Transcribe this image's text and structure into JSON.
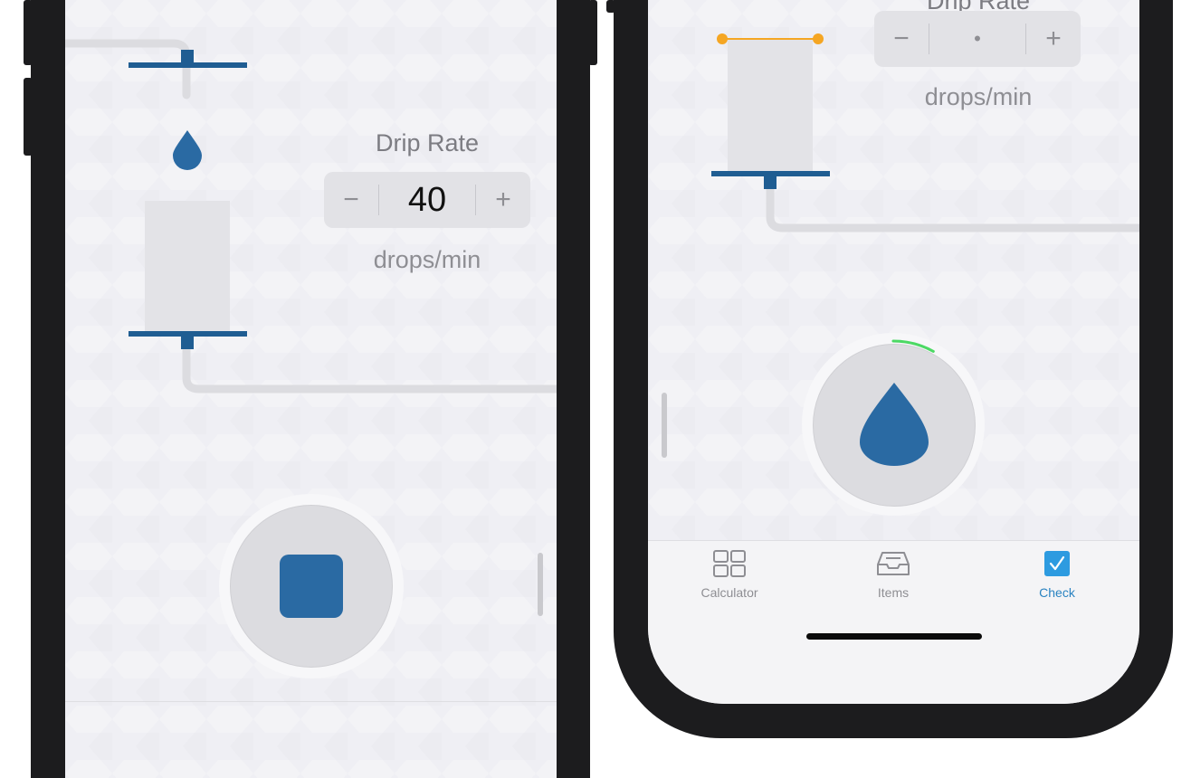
{
  "left_screen": {
    "drip_rate_title": "Drip Rate",
    "stepper": {
      "minus": "−",
      "value": "40",
      "plus": "+"
    },
    "unit": "drops/min",
    "action_button": {
      "icon": "stop-square-icon"
    }
  },
  "right_screen": {
    "drip_rate_title": "Drip Rate",
    "stepper": {
      "minus": "−",
      "value": "•",
      "plus": "+"
    },
    "unit": "drops/min",
    "action_button": {
      "icon": "water-drop-icon",
      "progress": 0.08
    },
    "tabbar": {
      "tabs": [
        {
          "label": "Calculator",
          "icon": "grid-icon",
          "active": false
        },
        {
          "label": "Items",
          "icon": "inbox-tray-icon",
          "active": false
        },
        {
          "label": "Check",
          "icon": "checkbox-icon",
          "active": true
        }
      ]
    }
  },
  "colors": {
    "accent_blue": "#1f5d92",
    "drop_blue": "#2a6aa3",
    "active_tab": "#2a83c1",
    "progress_green": "#4cd964",
    "handle_orange": "#f5a623"
  }
}
